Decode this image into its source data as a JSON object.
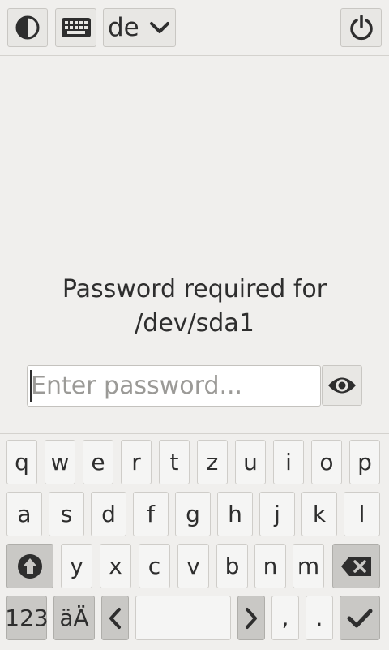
{
  "topbar": {
    "contrast_icon": "contrast-icon",
    "keyboard_icon": "keyboard-icon",
    "layout_selected": "de",
    "layout_chevron_icon": "chevron-down-icon",
    "power_icon": "power-icon"
  },
  "prompt": {
    "line1": "Password required for",
    "line2": "/dev/sda1"
  },
  "password": {
    "placeholder": "Enter password...",
    "value": "",
    "toggle_icon": "eye-icon"
  },
  "keyboard": {
    "row1": [
      "q",
      "w",
      "e",
      "r",
      "t",
      "z",
      "u",
      "i",
      "o",
      "p"
    ],
    "row2": [
      "a",
      "s",
      "d",
      "f",
      "g",
      "h",
      "j",
      "k",
      "l"
    ],
    "row3": [
      "y",
      "x",
      "c",
      "v",
      "b",
      "n",
      "m"
    ],
    "shift_icon": "shift-up-arrow-icon",
    "backspace_icon": "backspace-icon",
    "numbers_label": "123",
    "umlaut_label": "äÄ",
    "left_icon": "chevron-left-icon",
    "space_label": "",
    "right_icon": "chevron-right-icon",
    "comma_label": ",",
    "period_label": ".",
    "enter_icon": "checkmark-icon"
  },
  "colors": {
    "background": "#f0efed",
    "key": "#f5f5f4",
    "key_dark": "#c9c8c5",
    "text": "#2e2e2e"
  }
}
